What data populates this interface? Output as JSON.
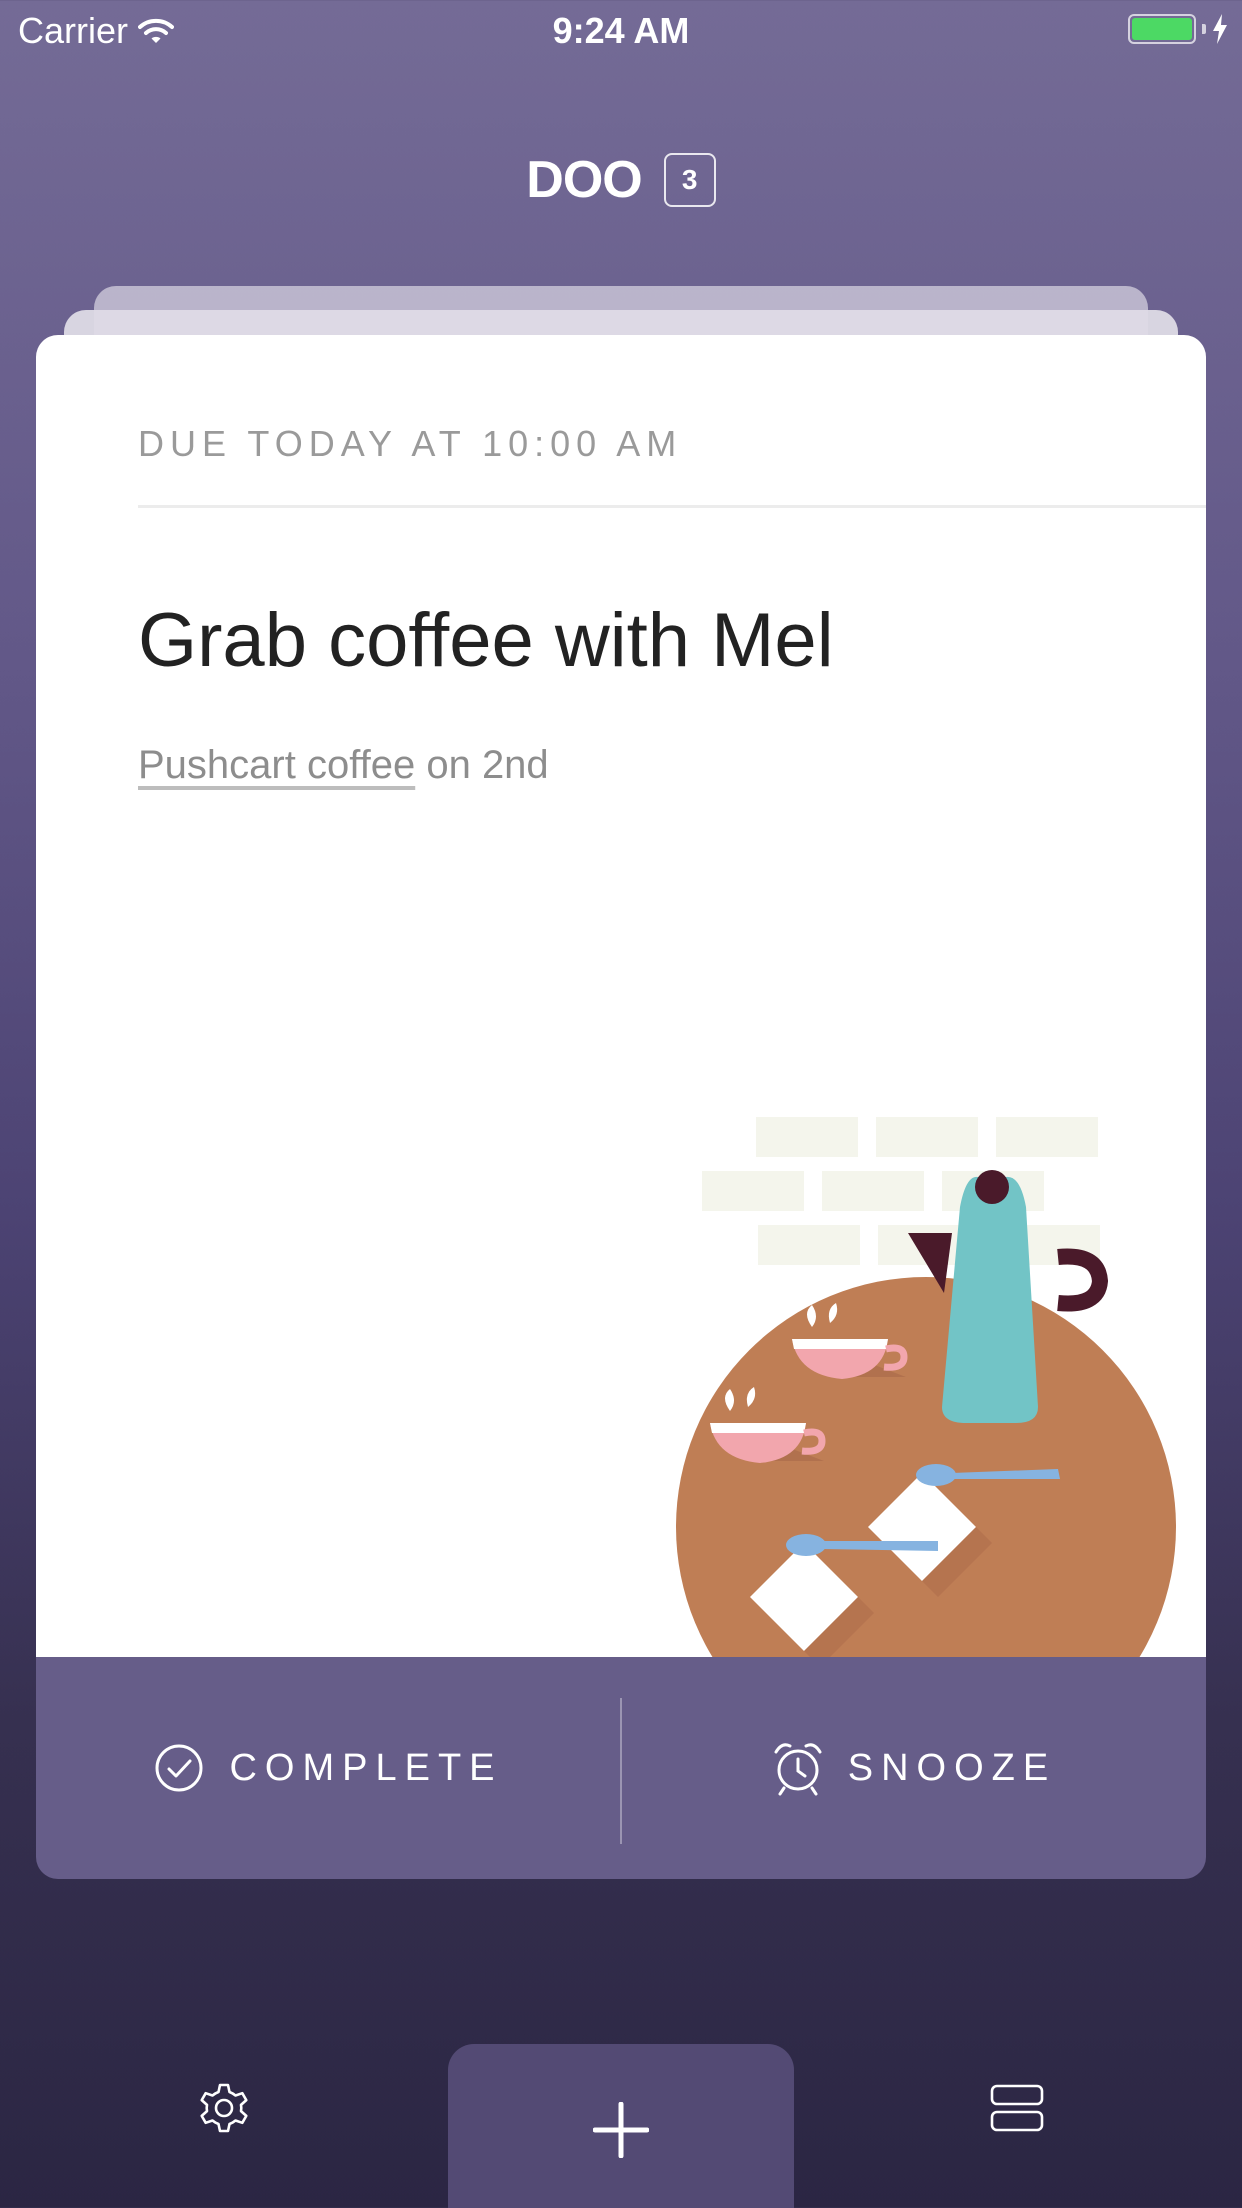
{
  "status_bar": {
    "carrier": "Carrier",
    "time": "9:24 AM",
    "battery_level": 1.0,
    "battery_color": "#4cd964"
  },
  "header": {
    "title": "DOO",
    "count": "3"
  },
  "card": {
    "due": "DUE TODAY AT 10:00 AM",
    "title": "Grab coffee with Mel",
    "note_link": "Pushcart coffee",
    "note_rest": " on 2nd",
    "illustration": "coffee-table-illustration"
  },
  "actions": {
    "complete_label": "COMPLETE",
    "complete_icon": "check-circle-icon",
    "snooze_label": "SNOOZE",
    "snooze_icon": "alarm-clock-icon"
  },
  "toolbar": {
    "settings_icon": "gear-icon",
    "add_icon": "plus-icon",
    "list_icon": "stack-view-icon"
  },
  "colors": {
    "background_top": "#746b96",
    "background_bottom": "#2b2643",
    "action_bar": "#665d89",
    "add_button": "#534a74"
  }
}
